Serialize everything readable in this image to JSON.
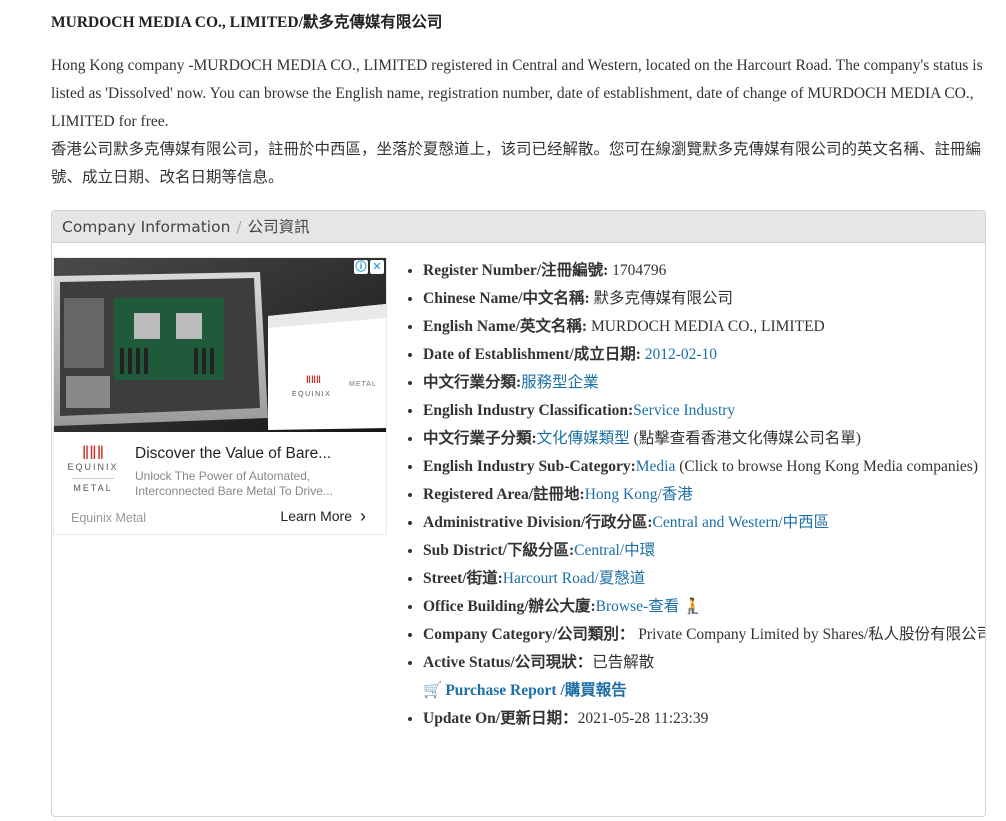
{
  "page": {
    "title": "MURDOCH MEDIA CO., LIMITED/默多克傳媒有限公司",
    "intro_en": "Hong Kong company -MURDOCH MEDIA CO., LIMITED registered in Central and Western, located on the Harcourt Road. The company's status is listed as 'Dissolved' now. You can browse the English name, registration number, date of establishment, date of change of MURDOCH MEDIA CO., LIMITED for free.",
    "intro_zh": "香港公司默多克傳媒有限公司，註冊於中西區，坐落於夏慤道上，该司已经解散。您可在線瀏覽默多克傳媒有限公司的英文名稱、註冊編號、成立日期、改名日期等信息。"
  },
  "panel": {
    "header_en": "Company Information",
    "header_sep": "/",
    "header_zh": "公司資訊"
  },
  "ad": {
    "brand_top": "EQUINIX",
    "brand_bottom": "METAL",
    "image_brand": "EQUINIX",
    "image_sub": "METAL",
    "headline": "Discover the Value of Bare...",
    "desc_line1": "Unlock The Power of Automated,",
    "desc_line2": "Interconnected Bare Metal To Drive...",
    "advertiser": "Equinix Metal",
    "cta": "Learn More"
  },
  "info": {
    "register_number": {
      "label": "Register Number/注冊編號:",
      "value": " 1704796"
    },
    "chinese_name": {
      "label": "Chinese Name/中文名稱:",
      "value": " 默多克傳媒有限公司"
    },
    "english_name": {
      "label": "English Name/英文名稱:",
      "value": " MURDOCH MEDIA CO., LIMITED"
    },
    "date_est": {
      "label": "Date of Establishment/成立日期:",
      "value": "2012-02-10"
    },
    "industry_zh": {
      "label": "中文行業分類:",
      "value": "服務型企業"
    },
    "industry_en": {
      "label": "English Industry Classification:",
      "value": "Service Industry"
    },
    "subcat_zh": {
      "label": "中文行業子分類:",
      "value": "文化傳媒類型",
      "note": " (點擊查看香港文化傳媒公司名單)"
    },
    "subcat_en": {
      "label": "English Industry Sub-Category:",
      "value": "Media",
      "note": " (Click to browse Hong Kong Media companies)"
    },
    "registered_area": {
      "label": "Registered Area/註冊地:",
      "value": "Hong Kong/香港"
    },
    "admin_division": {
      "label": "Administrative Division/行政分區:",
      "value": "Central and Western/中西區"
    },
    "sub_district": {
      "label": "Sub District/下級分區:",
      "value": "Central/中環"
    },
    "street": {
      "label": "Street/街道:",
      "value": "Harcourt Road/夏慤道"
    },
    "office_building": {
      "label": "Office Building/辦公大廈:",
      "value": "Browse-查看",
      "emoji": "🧎"
    },
    "company_category": {
      "label": "Company Category/公司類別",
      "sep": "：",
      "value": " Private Company Limited by Shares/私人股份有限公司"
    },
    "active_status": {
      "label": "Active Status/公司現狀",
      "sep": "：",
      "value": "已告解散"
    },
    "purchase": {
      "icon": "🛒",
      "label": "Purchase Report /購買報告"
    },
    "update_on": {
      "label": "Update On/更新日期",
      "sep": "：",
      "value": "2021-05-28 11:23:39"
    }
  }
}
